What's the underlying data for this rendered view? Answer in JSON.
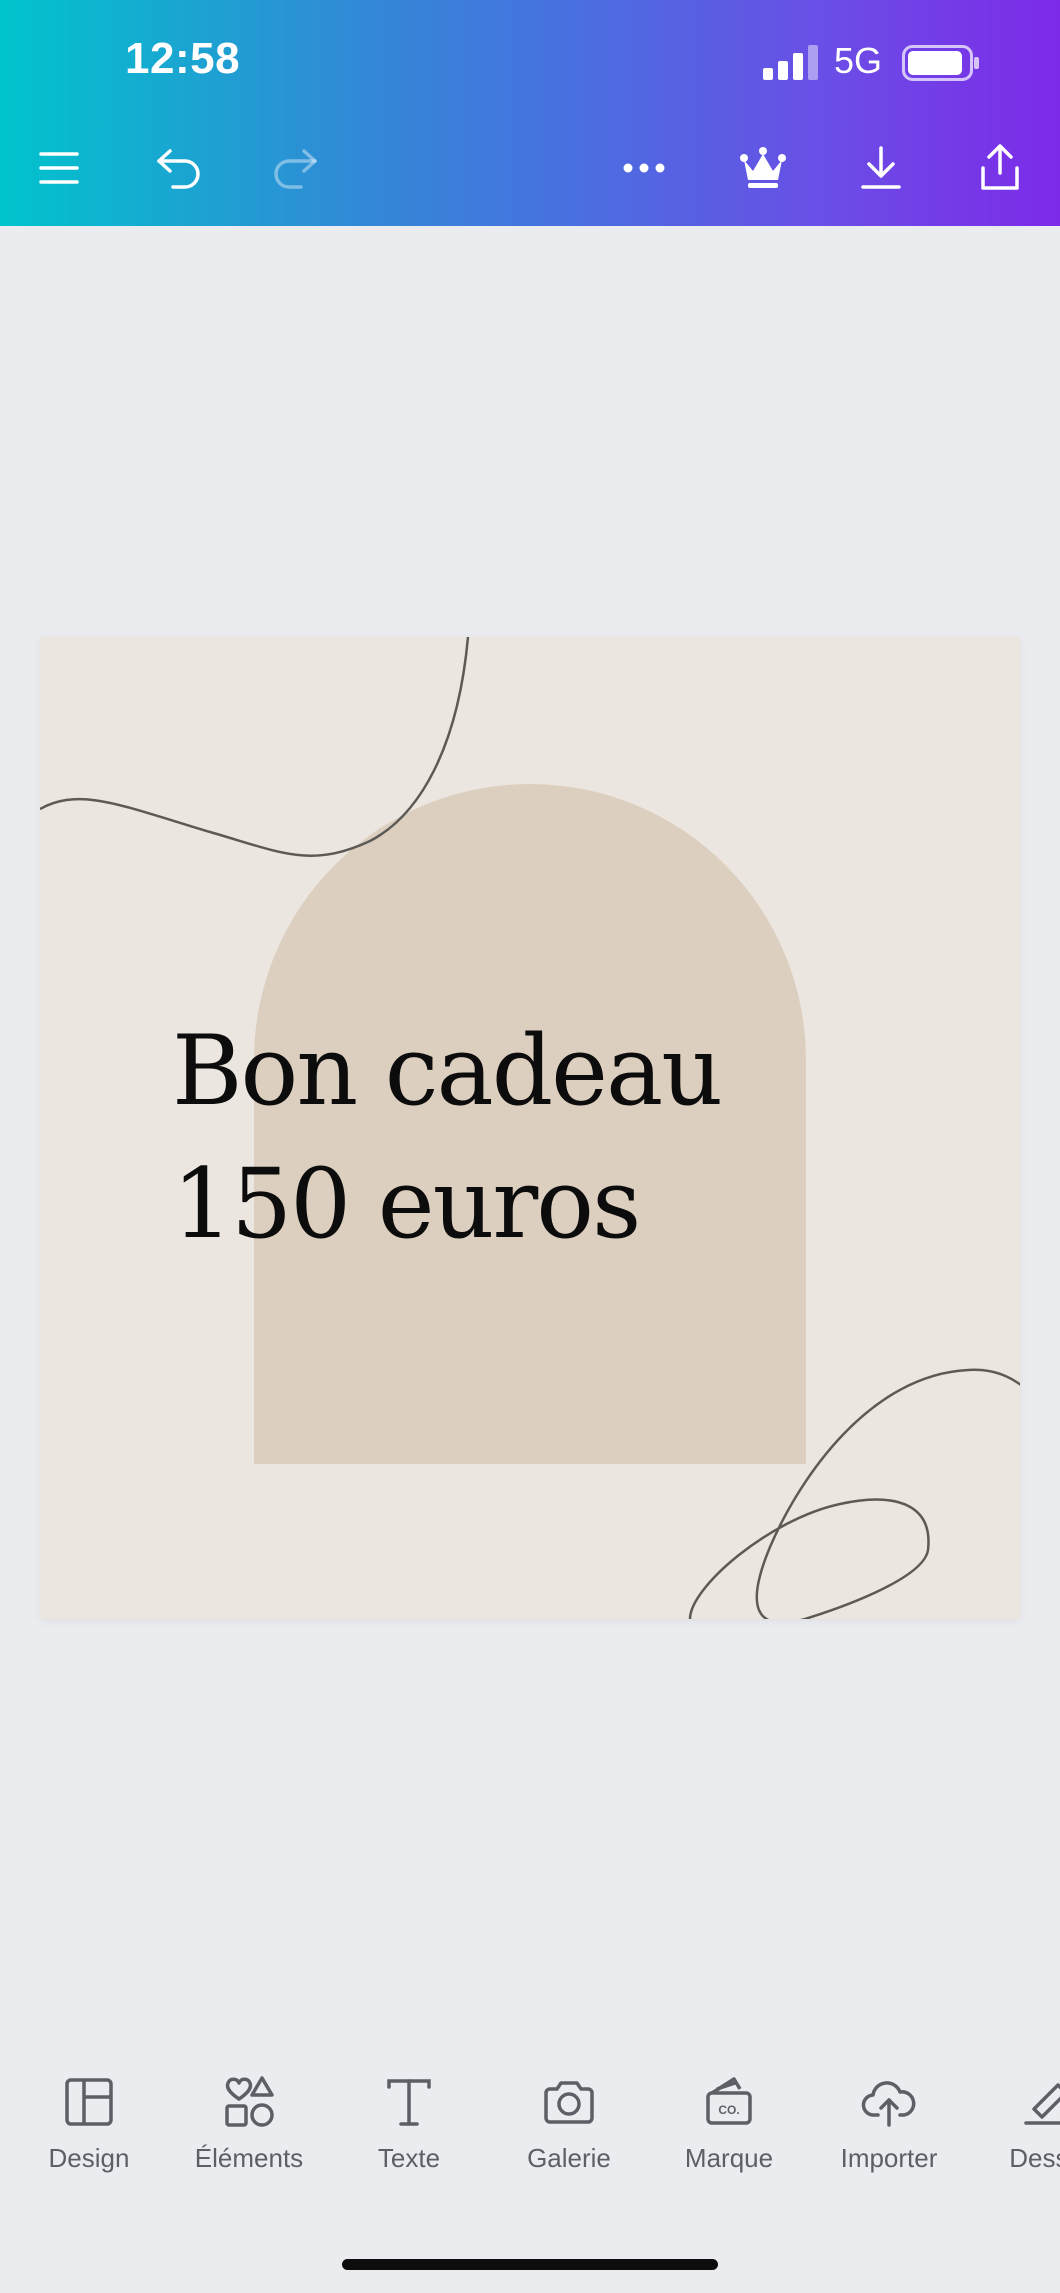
{
  "status_bar": {
    "time": "12:58",
    "network": "5G",
    "signal_bars": 4,
    "signal_bars_active": 3,
    "battery_level": 0.85
  },
  "toolbar": {
    "buttons": [
      {
        "name": "menu",
        "icon": "hamburger-icon",
        "enabled": true
      },
      {
        "name": "undo",
        "icon": "undo-icon",
        "enabled": true
      },
      {
        "name": "redo",
        "icon": "redo-icon",
        "enabled": false
      },
      {
        "name": "more",
        "icon": "more-horizontal-icon",
        "enabled": true
      },
      {
        "name": "premium",
        "icon": "crown-icon",
        "enabled": true
      },
      {
        "name": "download",
        "icon": "download-icon",
        "enabled": true
      },
      {
        "name": "share",
        "icon": "share-icon",
        "enabled": true
      }
    ],
    "gradient_start": "#00c4cc",
    "gradient_end": "#7d2ae8"
  },
  "design": {
    "text_line_1": "Bon cadeau",
    "text_line_2": "150 euros",
    "background_color": "#ebe6df",
    "arch_color": "#ddcfbf",
    "line_color": "#5d5a55"
  },
  "bottom_nav": {
    "items": [
      {
        "label": "Design",
        "icon": "layout-icon"
      },
      {
        "label": "Éléments",
        "icon": "shapes-icon"
      },
      {
        "label": "Texte",
        "icon": "text-icon"
      },
      {
        "label": "Galerie",
        "icon": "camera-icon"
      },
      {
        "label": "Marque",
        "icon": "brand-icon"
      },
      {
        "label": "Importer",
        "icon": "upload-cloud-icon"
      },
      {
        "label": "Dessin",
        "icon": "draw-icon"
      }
    ]
  },
  "colors": {
    "app_background": "#ebecf0",
    "nav_text": "#5c5f66"
  }
}
